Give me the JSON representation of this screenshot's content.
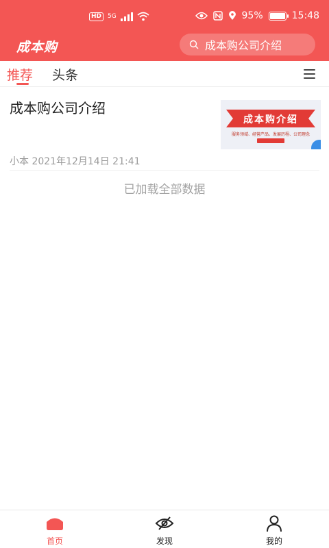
{
  "status_bar": {
    "hd": "HD",
    "network": "5G",
    "battery_text": "95%",
    "battery_level": 0.95,
    "time": "15:48"
  },
  "header": {
    "logo": "成本购",
    "search_text": "成本购公司介绍"
  },
  "tabs": [
    {
      "label": "推荐",
      "active": true
    },
    {
      "label": "头条",
      "active": false
    }
  ],
  "article": {
    "title": "成本购公司介绍",
    "meta": "小本 2021年12月14日 21:41",
    "thumbnail": {
      "title": "成本购介绍",
      "subtitle": "服务领域、经营产品、发展历程、公司理念"
    }
  },
  "feed_end_text": "已加载全部数据",
  "bottom_nav": [
    {
      "label": "首页",
      "icon": "home-icon",
      "active": true
    },
    {
      "label": "发现",
      "icon": "discover-icon",
      "active": false
    },
    {
      "label": "我的",
      "icon": "profile-icon",
      "active": false
    }
  ],
  "colors": {
    "accent": "#f35654",
    "muted_text": "#9a9a9a"
  }
}
